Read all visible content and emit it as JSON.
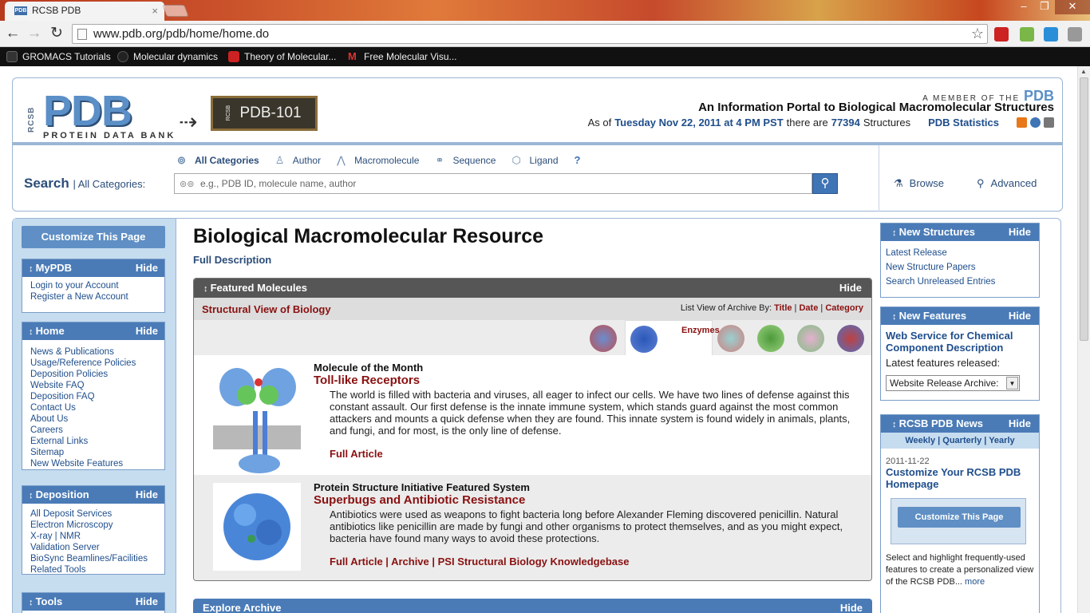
{
  "browser": {
    "tab_title": "RCSB PDB",
    "url": "www.pdb.org/pdb/home/home.do",
    "bookmarks": [
      "GROMACS Tutorials",
      "Molecular dynamics",
      "Theory of Molecular...",
      "Free Molecular Visu..."
    ]
  },
  "header": {
    "logo_text": "PDB",
    "logo_vertical": "RCSB",
    "logo_subtitle": "PROTEIN DATA BANK",
    "pdb101": "PDB-101",
    "pdb101_small": "RCSB",
    "member_prefix": "A MEMBER OF THE",
    "member_org": "PDB",
    "portal_title": "An Information Portal to Biological Macromolecular Structures",
    "as_of": "As of",
    "date": "Tuesday Nov 22, 2011 at 4 PM PST",
    "there_are": "there are",
    "count": "77394",
    "structures": "Structures",
    "stats_link": "PDB Statistics"
  },
  "search": {
    "label": "Search",
    "sublabel": "| All Categories:",
    "categories": [
      "All Categories",
      "Author",
      "Macromolecule",
      "Sequence",
      "Ligand"
    ],
    "help": "?",
    "placeholder": "e.g., PDB ID, molecule name, author",
    "browse": "Browse",
    "advanced": "Advanced"
  },
  "left": {
    "customize": "Customize This Page",
    "hide": "Hide",
    "mypdb": {
      "title": "MyPDB",
      "items": [
        "Login to your Account",
        "Register a New Account"
      ]
    },
    "home": {
      "title": "Home",
      "items": [
        "News & Publications",
        "Usage/Reference Policies",
        "Deposition Policies",
        "Website FAQ",
        "Deposition FAQ",
        "Contact Us",
        "About Us",
        "Careers",
        "External Links",
        "Sitemap",
        "New Website Features"
      ]
    },
    "deposition": {
      "title": "Deposition",
      "items": [
        "All Deposit Services",
        "Electron Microscopy",
        "X-ray | NMR",
        "Validation Server",
        "BioSync Beamlines/Facilities",
        "Related Tools"
      ]
    },
    "tools": {
      "title": "Tools"
    }
  },
  "main": {
    "title": "Biological Macromolecular Resource",
    "full_description": "Full Description",
    "featured": {
      "title": "Featured Molecules",
      "hide": "Hide",
      "structural_view": "Structural View of Biology",
      "list_view_prefix": "List View of Archive By:",
      "list_title": "Title",
      "list_date": "Date",
      "list_category": "Category",
      "active_tab": "Enzymes",
      "molecules": [
        {
          "kicker": "Molecule of the Month",
          "title": "Toll-like Receptors",
          "desc": "The world is filled with bacteria and viruses, all eager to infect our cells. We have two lines of defense against this constant assault. Our first defense is the innate immune system, which stands guard against the most common attackers and mounts a quick defense when they are found. This innate system is found widely in animals, plants, and fungi, and for most, is the only line of defense.",
          "links": "Full Article"
        },
        {
          "kicker": "Protein Structure Initiative Featured System",
          "title": "Superbugs and Antibiotic Resistance",
          "desc": "Antibiotics were used as weapons to fight bacteria long before Alexander Fleming discovered penicillin. Natural antibiotics like penicillin are made by fungi and other organisms to protect themselves, and as you might expect, bacteria have found many ways to avoid these protections.",
          "links": "Full Article | Archive | PSI Structural Biology Knowledgebase"
        }
      ]
    },
    "explore": {
      "title": "Explore Archive",
      "hide": "Hide"
    }
  },
  "right": {
    "hide": "Hide",
    "new_structures": {
      "title": "New Structures",
      "items": [
        "Latest Release",
        "New Structure Papers",
        "Search Unreleased Entries"
      ]
    },
    "new_features": {
      "title": "New Features",
      "headline": "Web Service for Chemical Component Description",
      "released": "Latest features released:",
      "select": "Website Release Archive:"
    },
    "news": {
      "title": "RCSB PDB News",
      "weekly": "Weekly",
      "quarterly": "Quarterly",
      "yearly": "Yearly",
      "date": "2011-11-22",
      "headline": "Customize Your RCSB PDB Homepage",
      "button": "Customize This Page",
      "desc": "Select and highlight frequently-used features to create a personalized view of the RCSB PDB...",
      "more": "more"
    }
  },
  "colors": {
    "accent": "#4a7bb7",
    "brand_red": "#8a1010",
    "panel_bg": "#c6dcef"
  }
}
